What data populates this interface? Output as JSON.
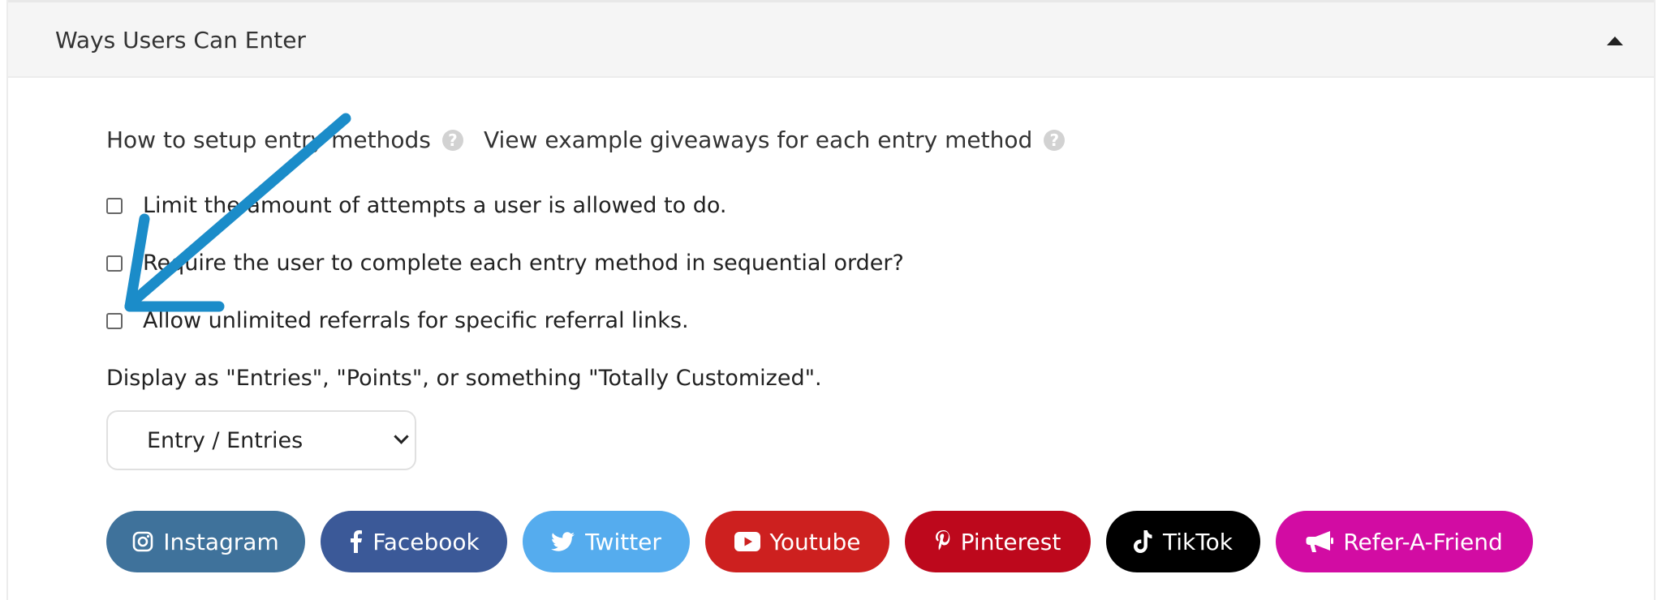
{
  "panel": {
    "title": "Ways Users Can Enter"
  },
  "links": {
    "setup": "How to setup entry methods",
    "examples": "View example giveaways for each entry method",
    "help_glyph": "?"
  },
  "options": [
    {
      "label": "Limit the amount of attempts a user is allowed to do.",
      "checked": false
    },
    {
      "label": "Require the user to complete each entry method in sequential order?",
      "checked": false
    },
    {
      "label": "Allow unlimited referrals for specific referral links.",
      "checked": false
    }
  ],
  "display": {
    "label": "Display as \"Entries\", \"Points\", or something \"Totally Customized\".",
    "selected": "Entry / Entries"
  },
  "entry_buttons": [
    {
      "label": "Instagram",
      "icon": "instagram-icon",
      "color": "#3f729b"
    },
    {
      "label": "Facebook",
      "icon": "facebook-icon",
      "color": "#3b5998"
    },
    {
      "label": "Twitter",
      "icon": "twitter-icon",
      "color": "#55acee"
    },
    {
      "label": "Youtube",
      "icon": "youtube-icon",
      "color": "#cd201f"
    },
    {
      "label": "Pinterest",
      "icon": "pinterest-icon",
      "color": "#bd081c"
    },
    {
      "label": "TikTok",
      "icon": "tiktok-icon",
      "color": "#000000"
    },
    {
      "label": "Refer-A-Friend",
      "icon": "megaphone-icon",
      "color": "#d20ca3"
    }
  ],
  "colors": {
    "link": "#18a9d9",
    "annotation_arrow": "#1b8cc9"
  }
}
